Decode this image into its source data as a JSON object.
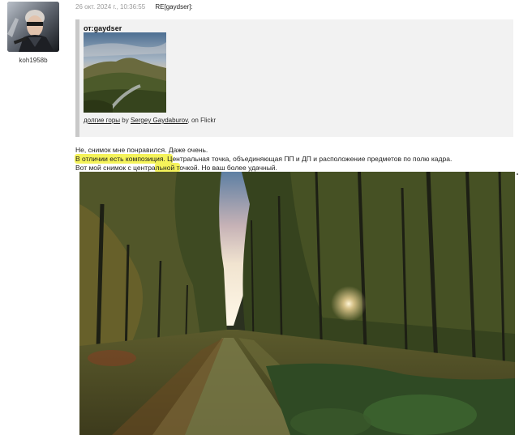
{
  "author": {
    "username": "koh1958b"
  },
  "post": {
    "timestamp": "26 окт. 2024 г., 10:36:55",
    "subject": "RE[gaydser]:"
  },
  "quote": {
    "author_line": "от:gaydser",
    "photo_title": "долгие горы",
    "caption_by": " by ",
    "photographer": "Sergey Gaydaburov",
    "caption_on": ", on Flickr"
  },
  "body": {
    "line1": "Не, снимок мне понравился. Даже очень.",
    "line2_highlight": "В отличии есть композиция. Ц",
    "line2_rest": "ентральная точка, объединяющая ПП и ДП и расположение предметов по полю кадра.",
    "line3_part1": "Вот мой снимок с центра",
    "line3_highlight": "льной т",
    "line3_part2": "очкой. Но ваш более удачный."
  },
  "colors": {
    "highlight": "#f5f35a",
    "quote_bg": "#f2f2f2",
    "quote_bar": "#c9c9c9"
  },
  "icons": {
    "avatar": "user-avatar-image"
  }
}
